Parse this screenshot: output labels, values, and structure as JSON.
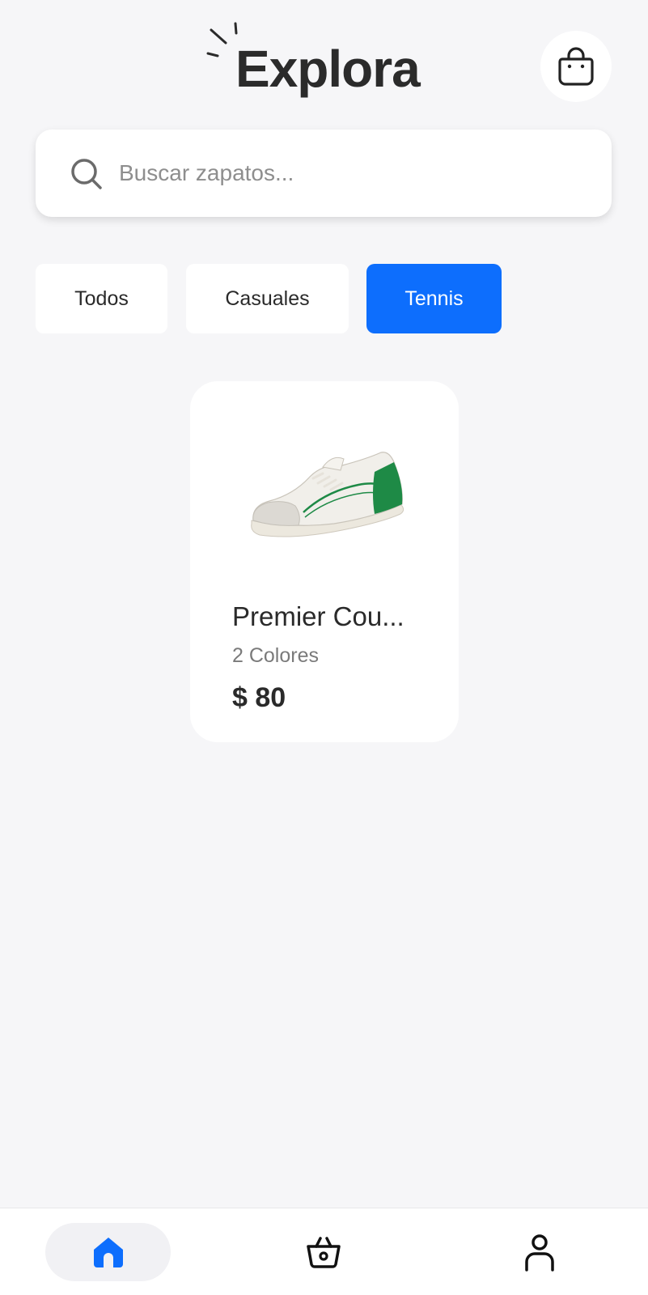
{
  "header": {
    "title": "Explora",
    "cart_icon": "shopping-bag-icon"
  },
  "search": {
    "placeholder": "Buscar zapatos...",
    "value": "",
    "icon": "search-icon"
  },
  "categories": [
    {
      "label": "Todos",
      "active": false
    },
    {
      "label": "Casuales",
      "active": false
    },
    {
      "label": "Tennis",
      "active": true
    }
  ],
  "products": [
    {
      "name": "Premier Cou...",
      "colors": "2 Colores",
      "price": "$ 80",
      "image": "sneaker-image"
    }
  ],
  "bottom_nav": {
    "items": [
      {
        "icon": "home-icon",
        "active": true
      },
      {
        "icon": "basket-icon",
        "active": false
      },
      {
        "icon": "user-icon",
        "active": false
      }
    ]
  },
  "colors": {
    "accent": "#0d6efd",
    "background": "#f6f6f8",
    "card": "#ffffff",
    "text": "#2a2a2a",
    "muted": "#7a7a7a",
    "shoe_accent": "#1e8a46"
  }
}
